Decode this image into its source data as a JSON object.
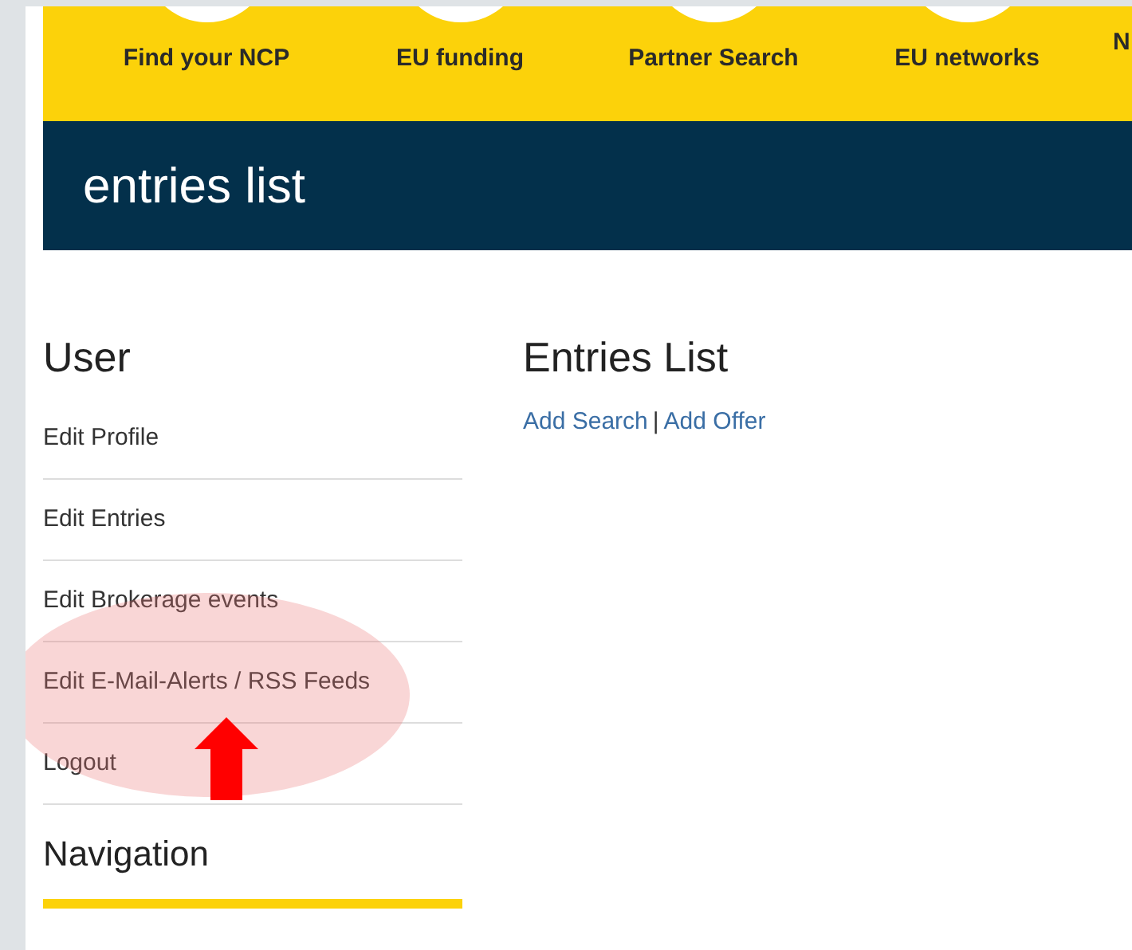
{
  "top_nav": {
    "items": [
      {
        "label": "Find your NCP"
      },
      {
        "label": "EU funding"
      },
      {
        "label": "Partner Search"
      },
      {
        "label": "EU networks"
      },
      {
        "label": "N"
      }
    ]
  },
  "page_title": "entries list",
  "sidebar": {
    "user_heading": "User",
    "items": [
      {
        "label": "Edit Profile"
      },
      {
        "label": "Edit Entries"
      },
      {
        "label": "Edit Brokerage events"
      },
      {
        "label": "Edit E-Mail-Alerts / RSS Feeds"
      },
      {
        "label": "Logout"
      }
    ],
    "navigation_heading": "Navigation"
  },
  "main": {
    "heading": "Entries List",
    "links": [
      {
        "label": "Add Search"
      },
      {
        "label": "Add Offer"
      }
    ],
    "separator": "|"
  }
}
